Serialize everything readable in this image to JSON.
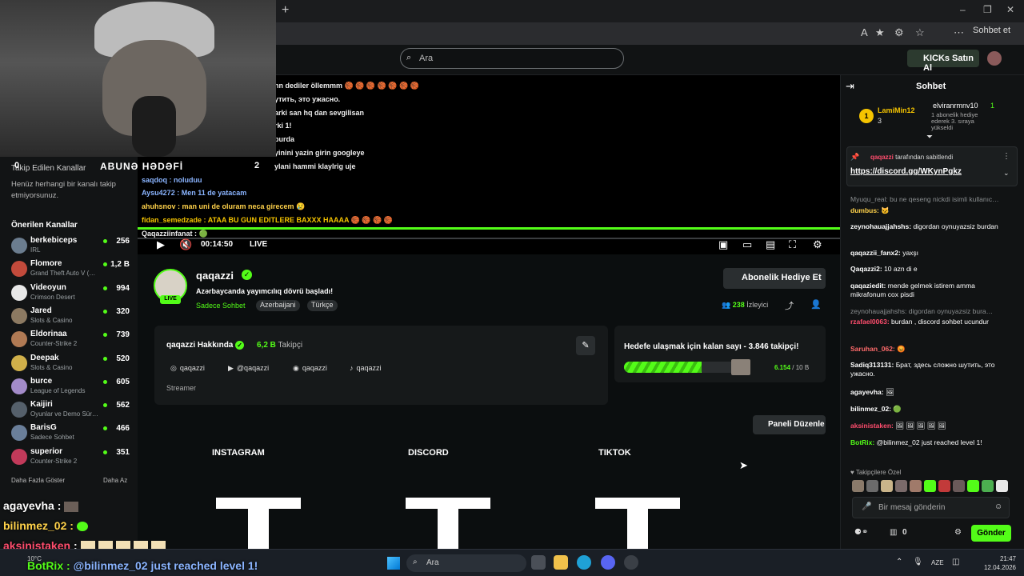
{
  "browser": {
    "tab_new": "+",
    "profile_label": "Sohbet et",
    "window_controls": [
      "–",
      "❐",
      "✕"
    ]
  },
  "header": {
    "search_placeholder": "Ara",
    "kicks_button": "KICKs Satın Al"
  },
  "webcam_overlay": {
    "left_count": "0",
    "center": "ABUNƏ HƏDƏFİ",
    "right_count": "2"
  },
  "sidebar": {
    "following_title": "Takip Edilen Kanallar",
    "following_empty": "Henüz herhangi bir kanalı takip etmiyorsunuz.",
    "recommended_title": "Önerilen Kanallar",
    "channels": [
      {
        "name": "berkebiceps",
        "category": "IRL",
        "viewers": "256",
        "color": "#6b7d8f"
      },
      {
        "name": "Flomore",
        "category": "Grand Theft Auto V (…",
        "viewers": "1,2 B",
        "color": "#c24a3b"
      },
      {
        "name": "Videoyun",
        "category": "Crimson Desert",
        "viewers": "994",
        "color": "#e8e8e8"
      },
      {
        "name": "Jared",
        "category": "Slots & Casino",
        "viewers": "320",
        "color": "#8c7a62"
      },
      {
        "name": "Eldorinaa",
        "category": "Counter-Strike 2",
        "viewers": "739",
        "color": "#b07a54"
      },
      {
        "name": "Deepak",
        "category": "Slots & Casino",
        "viewers": "520",
        "color": "#d0b04a"
      },
      {
        "name": "burce",
        "category": "League of Legends",
        "viewers": "605",
        "color": "#a38bc9"
      },
      {
        "name": "Kaijiri",
        "category": "Oyunlar ve Demo Sür…",
        "viewers": "562",
        "color": "#55606b"
      },
      {
        "name": "BarisG",
        "category": "Sadece Sohbet",
        "viewers": "466",
        "color": "#6a7f9a"
      },
      {
        "name": "superior",
        "category": "Counter-Strike 2",
        "viewers": "351",
        "color": "#c23a5a"
      }
    ],
    "show_more": "Daha Fazla Göster",
    "show_less": "Daha Az"
  },
  "video": {
    "chat_lines": [
      "nn dediler öllemmm 🏀 🏀 🏀 🏀 🏀 🏀 🏀",
      "утить, это ужасно.",
      "arki san hq dan sevgilisan",
      "rki 1!",
      "burda",
      "yinini yazin girin googleye",
      "ylani hammi klaylrig uje",
      "saqdoq : noluduu",
      "Aysu4272 : Men 11 de yatacam",
      "ahuhsnov : man uni de oluram neca girecem 😢",
      "fidan_semedzade : ATAA BU GUN EDITLERE BAXXX HAAAA 🏀 🏀 🏀 🏀",
      "Qaqazziinfanat : 🟢"
    ],
    "time": "00:14:50",
    "live": "LIVE"
  },
  "channel": {
    "name": "qaqazzi",
    "live_badge": "LIVE",
    "title": "Azərbaycanda yayımcılıq dövrü başladı!",
    "category": "Sadece Sohbet",
    "tags": [
      "Azerbaijani",
      "Türkçe"
    ],
    "gift_button": "Abonelik Hediye Et",
    "viewer_count": "238",
    "viewer_label": "İzleyici"
  },
  "about": {
    "title": "qaqazzi Hakkında",
    "followers": "6,2 B",
    "followers_label": "Takipçi",
    "socials": [
      {
        "icon": "instagram-icon",
        "glyph": "◎",
        "label": "qaqazzi"
      },
      {
        "icon": "youtube-icon",
        "glyph": "▶",
        "label": "@qaqazzi"
      },
      {
        "icon": "discord-icon",
        "glyph": "◉",
        "label": "qaqazzi"
      },
      {
        "icon": "tiktok-icon",
        "glyph": "♪",
        "label": "qaqazzi"
      }
    ],
    "role": "Streamer"
  },
  "goal": {
    "text": "Hedefe ulaşmak için kalan sayı - 3.846 takipçi!",
    "current": "6.154",
    "target": "10 B",
    "progress_fraction": 0.6154
  },
  "panels": {
    "edit_button": "Paneli Düzenle",
    "items": [
      "INSTAGRAM",
      "DISCORD",
      "TIKTOK"
    ]
  },
  "chat": {
    "title": "Sohbet",
    "top_gifter_name": "LamiMin12",
    "top_gifter_count": "3",
    "gifter2_name": "elviranrmnv10",
    "gifter2_count": "1",
    "gifter2_note": "1 abonelik hediye ederek 3. sıraya yükseldi",
    "pin_user": "qaqazzi",
    "pin_label": "tarafından sabitlendi",
    "pin_link": "https://discord.gg/WKynPgkz",
    "messages": [
      {
        "user": "",
        "text": "Myuqu_real: bu ne qeseng nickdi isimli kullanıc…",
        "color": "#8a8e90",
        "dim": true
      },
      {
        "user": "dumbus:",
        "text": "🐱",
        "color": "#ffd24a"
      },
      {
        "user": "zeynohauajjahshs:",
        "text": "digordan oynuyazsiz burdan",
        "color": "#ffffff"
      },
      {
        "user": "qaqazzii_fanx2:",
        "text": "yaxşı",
        "color": "#ffffff"
      },
      {
        "user": "Qaqazzi2:",
        "text": "10 azn di e",
        "color": "#ffffff"
      },
      {
        "user": "qaqaziedit:",
        "text": "mende gelmek istirem amma mikrafonum cox pisdi",
        "color": "#ffffff"
      },
      {
        "user": "",
        "text": "zeynohauajjahshs: digordan oynuyazsiz bura…",
        "color": "#8a8e90",
        "dim": true
      },
      {
        "user": "rzafael0063:",
        "text": "burdan , discord sohbet ucundur",
        "color": "#ff4d6d"
      },
      {
        "user": "Saruhan_062:",
        "text": "😡",
        "color": "#ff6b6b"
      },
      {
        "user": "Sadiq313131:",
        "text": "Брат, здесь сложно шутить, это ужасно.",
        "color": "#ffffff"
      },
      {
        "user": "agayevha:",
        "text": "🖼",
        "color": "#ffffff"
      },
      {
        "user": "bilinmez_02:",
        "text": "🟢",
        "color": "#ffffff"
      },
      {
        "user": "aksinistaken:",
        "text": "🖼 🖼 🖼 🖼 🖼",
        "color": "#ff4d6d"
      },
      {
        "user": "BotRix:",
        "text": "@bilinmez_02 just reached level 1!",
        "color": "#53fc18"
      }
    ],
    "followers_only": "Takipçilere Özel",
    "input_placeholder": "Bir mesaj gönderin",
    "kicks_count": "0",
    "send_button": "Gönder"
  },
  "overlay": {
    "line1_user": "agayevha",
    "line2_user": "bilinmez_02",
    "line3_user": "aksinistaken",
    "line4_user": "BotRix",
    "line4_text": "@bilinmez_02 just reached level 1!"
  },
  "taskbar": {
    "weather": "10°C",
    "search_placeholder": "Ara",
    "lang": "AZE",
    "time": "21:47",
    "date": "12.04.2026"
  }
}
